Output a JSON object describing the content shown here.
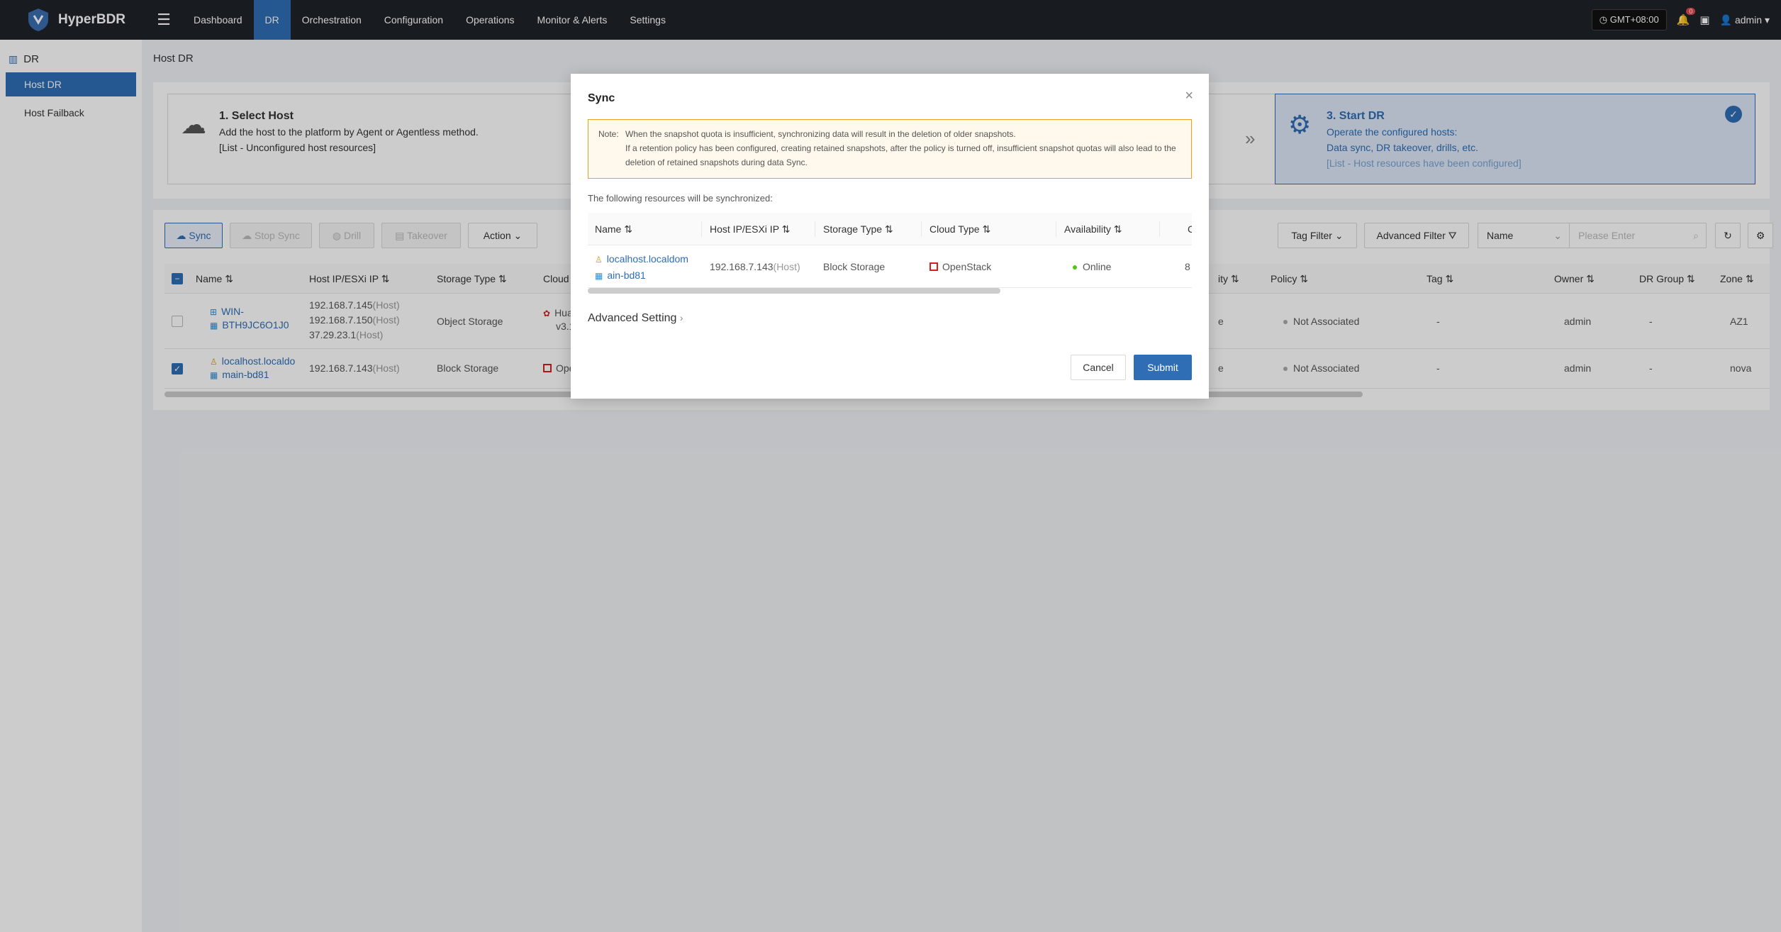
{
  "app": {
    "name": "HyperBDR"
  },
  "nav": {
    "items": [
      "Dashboard",
      "DR",
      "Orchestration",
      "Configuration",
      "Operations",
      "Monitor & Alerts",
      "Settings"
    ],
    "active": "DR"
  },
  "topright": {
    "timezone": "GMT+08:00",
    "alert_count": "0",
    "user": "admin"
  },
  "sidebar": {
    "group": "DR",
    "items": [
      {
        "label": "Host DR"
      },
      {
        "label": "Host Failback"
      }
    ]
  },
  "page": {
    "title": "Host DR"
  },
  "steps": {
    "step1": {
      "title": "1. Select Host",
      "line1": "Add the host to the platform by Agent or Agentless method.",
      "line2": "[List - Unconfigured host resources]"
    },
    "step3": {
      "title": "3. Start DR",
      "line1": "Operate the configured hosts:",
      "line2": "Data sync, DR takeover, drills, etc.",
      "line3": "[List - Host resources have been configured]"
    }
  },
  "toolbar": {
    "sync": "Sync",
    "stop_sync": "Stop Sync",
    "drill": "Drill",
    "takeover": "Takeover",
    "action": "Action",
    "tag_filter": "Tag Filter",
    "advanced_filter": "Advanced Filter",
    "filter_field": "Name",
    "search_placeholder": "Please Enter"
  },
  "table": {
    "headers": {
      "name": "Name",
      "host_ip": "Host IP/ESXi IP",
      "storage_type": "Storage Type",
      "cloud_type": "Cloud Typ",
      "availability": "ity",
      "policy": "Policy",
      "tag": "Tag",
      "owner": "Owner",
      "dr_group": "DR Group",
      "zone": "Zone"
    },
    "rows": [
      {
        "name_line1": "WIN-",
        "name_line2": "BTH9JC6O1J0",
        "ips": [
          {
            "ip": "192.168.7.145",
            "kind": "(Host)"
          },
          {
            "ip": "192.168.7.150",
            "kind": "(Host)"
          },
          {
            "ip": "37.29.23.1",
            "kind": "(Host)"
          }
        ],
        "storage_type": "Object Storage",
        "cloud_type_line1": "Huaw",
        "cloud_type_line2": "v3.1.8",
        "availability": "e",
        "policy": "Not Associated",
        "tag": "-",
        "owner": "admin",
        "dr_group": "-",
        "zone": "AZ1"
      },
      {
        "name_line1": "localhost.localdo",
        "name_line2": "main-bd81",
        "ips": [
          {
            "ip": "192.168.7.143",
            "kind": "(Host)"
          }
        ],
        "storage_type": "Block Storage",
        "cloud_type_line1": "Open",
        "availability": "e",
        "policy": "Not Associated",
        "tag": "-",
        "owner": "admin",
        "dr_group": "-",
        "zone": "nova"
      }
    ]
  },
  "modal": {
    "title": "Sync",
    "note_label": "Note:",
    "note_line1": "When the snapshot quota is insufficient, synchronizing data will result in the deletion of older snapshots.",
    "note_line2": "If a retention policy has been configured, creating retained snapshots, after the policy is turned off, insufficient snapshot quotas will also lead to the deletion of retained snapshots during data Sync.",
    "sync_label": "The following resources will be synchronized:",
    "headers": {
      "name": "Name",
      "host_ip": "Host IP/ESXi IP",
      "storage_type": "Storage Type",
      "cloud_type": "Cloud Type",
      "availability": "Availability",
      "more": "C"
    },
    "row": {
      "name_line1": "localhost.localdom",
      "name_line2": "ain-bd81",
      "ip": "192.168.7.143",
      "ip_kind": "(Host)",
      "storage_type": "Block Storage",
      "cloud_type": "OpenStack",
      "availability": "Online",
      "more": "8"
    },
    "advanced_setting": "Advanced Setting",
    "cancel": "Cancel",
    "submit": "Submit"
  },
  "colors": {
    "accent": "#2f6db5",
    "topbar": "#1f2329",
    "warning": "#f0a020",
    "online": "#52c41a"
  }
}
